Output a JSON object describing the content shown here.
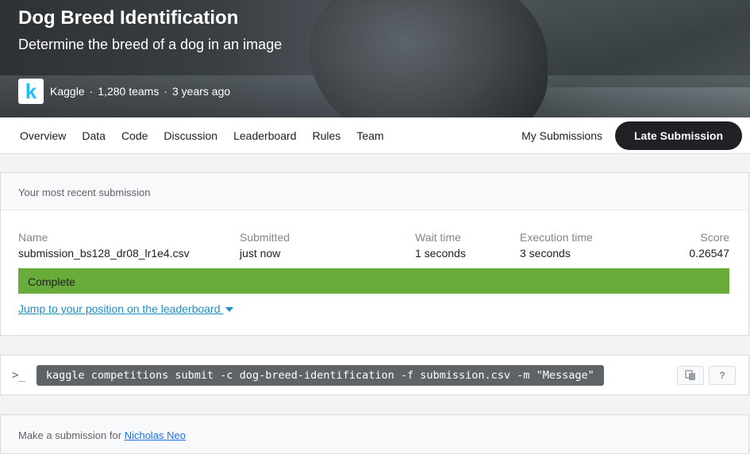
{
  "header": {
    "title": "Dog Breed Identification",
    "subtitle": "Determine the breed of a dog in an image",
    "host": "Kaggle",
    "teams": "1,280 teams",
    "age": "3 years ago",
    "separator": "·",
    "logo_letter": "k"
  },
  "nav": {
    "tabs": [
      "Overview",
      "Data",
      "Code",
      "Discussion",
      "Leaderboard",
      "Rules",
      "Team"
    ],
    "my_submissions": "My Submissions",
    "late_submission": "Late Submission"
  },
  "recent": {
    "heading": "Your most recent submission",
    "columns": [
      "Name",
      "Submitted",
      "Wait time",
      "Execution time",
      "Score"
    ],
    "row": {
      "name": "submission_bs128_dr08_lr1e4.csv",
      "submitted": "just now",
      "wait_time": "1 seconds",
      "execution_time": "3 seconds",
      "score": "0.26547"
    },
    "status": "Complete",
    "status_color": "#6aac3a",
    "jump_link": "Jump to your position on the leaderboard"
  },
  "cli": {
    "prompt": ">_",
    "command": "kaggle competitions submit -c dog-breed-identification -f submission.csv -m \"Message\"",
    "copy_icon": "copy-icon",
    "help_label": "?"
  },
  "submit": {
    "prefix": "Make a submission for",
    "user": "Nicholas Neo"
  }
}
